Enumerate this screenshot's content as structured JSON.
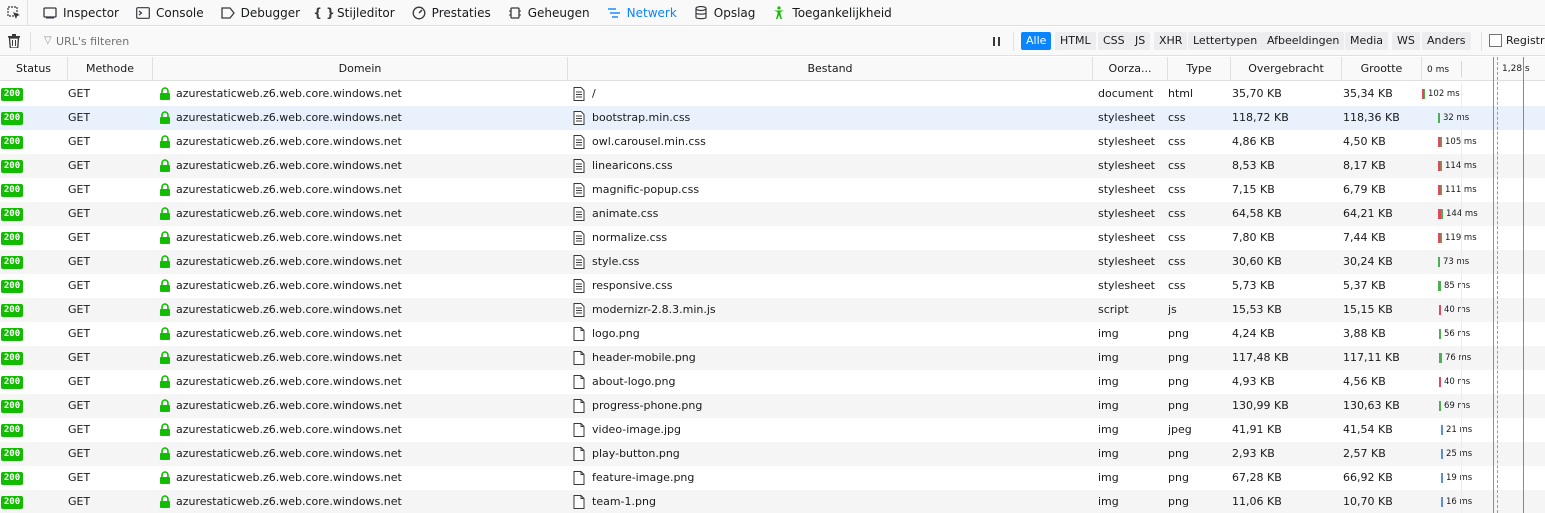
{
  "toolbar": {
    "tabs": [
      {
        "label": "Inspector",
        "icon": "inspector-icon"
      },
      {
        "label": "Console",
        "icon": "console-icon"
      },
      {
        "label": "Debugger",
        "icon": "debugger-icon"
      },
      {
        "label": "Stijleditor",
        "icon": "style-editor-icon"
      },
      {
        "label": "Prestaties",
        "icon": "performance-icon"
      },
      {
        "label": "Geheugen",
        "icon": "memory-icon"
      },
      {
        "label": "Netwerk",
        "icon": "network-icon",
        "active": true
      },
      {
        "label": "Opslag",
        "icon": "storage-icon"
      },
      {
        "label": "Toegankelijkheid",
        "icon": "accessibility-icon"
      }
    ]
  },
  "filter": {
    "placeholder": "URL's filteren",
    "types": [
      "Alle",
      "HTML",
      "CSS",
      "JS",
      "XHR",
      "Lettertypen",
      "Afbeeldingen",
      "Media",
      "WS",
      "Anders"
    ],
    "active_type": "Alle",
    "persist_label": "Registra"
  },
  "columns": {
    "status": "Status",
    "method": "Methode",
    "domain": "Domein",
    "file": "Bestand",
    "cause": "Oorza...",
    "type": "Type",
    "transferred": "Overgebracht",
    "size": "Grootte",
    "timeline_start": "0 ms",
    "timeline_mark": "1,28 s"
  },
  "colors": {
    "accent": "#0a84ff",
    "status_ok": "#12bc00",
    "bar_red": "#e3475b",
    "bar_green": "#4caf50",
    "bar_blue": "#5b8fd8",
    "line_blue": "#5b9bd5",
    "line_pink": "#e44fc8"
  },
  "rows": [
    {
      "status": "200",
      "method": "GET",
      "domain": "azurestaticweb.z6.web.core.windows.net",
      "file": "/",
      "file_kind": "doc",
      "cause": "document",
      "type": "html",
      "transferred": "35,70 KB",
      "size": "35,34 KB",
      "time": "102 ms",
      "time_ms": 102,
      "bar_start": 0.0
    },
    {
      "status": "200",
      "method": "GET",
      "domain": "azurestaticweb.z6.web.core.windows.net",
      "file": "bootstrap.min.css",
      "file_kind": "doc",
      "cause": "stylesheet",
      "type": "css",
      "transferred": "118,72 KB",
      "size": "118,36 KB",
      "time": "32 ms",
      "time_ms": 32,
      "bar_start": 0.16
    },
    {
      "status": "200",
      "method": "GET",
      "domain": "azurestaticweb.z6.web.core.windows.net",
      "file": "owl.carousel.min.css",
      "file_kind": "doc",
      "cause": "stylesheet",
      "type": "css",
      "transferred": "4,86 KB",
      "size": "4,50 KB",
      "time": "105 ms",
      "time_ms": 105,
      "bar_start": 0.16
    },
    {
      "status": "200",
      "method": "GET",
      "domain": "azurestaticweb.z6.web.core.windows.net",
      "file": "linearicons.css",
      "file_kind": "doc",
      "cause": "stylesheet",
      "type": "css",
      "transferred": "8,53 KB",
      "size": "8,17 KB",
      "time": "114 ms",
      "time_ms": 114,
      "bar_start": 0.16
    },
    {
      "status": "200",
      "method": "GET",
      "domain": "azurestaticweb.z6.web.core.windows.net",
      "file": "magnific-popup.css",
      "file_kind": "doc",
      "cause": "stylesheet",
      "type": "css",
      "transferred": "7,15 KB",
      "size": "6,79 KB",
      "time": "111 ms",
      "time_ms": 111,
      "bar_start": 0.16
    },
    {
      "status": "200",
      "method": "GET",
      "domain": "azurestaticweb.z6.web.core.windows.net",
      "file": "animate.css",
      "file_kind": "doc",
      "cause": "stylesheet",
      "type": "css",
      "transferred": "64,58 KB",
      "size": "64,21 KB",
      "time": "144 ms",
      "time_ms": 144,
      "bar_start": 0.16
    },
    {
      "status": "200",
      "method": "GET",
      "domain": "azurestaticweb.z6.web.core.windows.net",
      "file": "normalize.css",
      "file_kind": "doc",
      "cause": "stylesheet",
      "type": "css",
      "transferred": "7,80 KB",
      "size": "7,44 KB",
      "time": "119 ms",
      "time_ms": 119,
      "bar_start": 0.16
    },
    {
      "status": "200",
      "method": "GET",
      "domain": "azurestaticweb.z6.web.core.windows.net",
      "file": "style.css",
      "file_kind": "doc",
      "cause": "stylesheet",
      "type": "css",
      "transferred": "30,60 KB",
      "size": "30,24 KB",
      "time": "73 ms",
      "time_ms": 73,
      "bar_start": 0.16
    },
    {
      "status": "200",
      "method": "GET",
      "domain": "azurestaticweb.z6.web.core.windows.net",
      "file": "responsive.css",
      "file_kind": "doc",
      "cause": "stylesheet",
      "type": "css",
      "transferred": "5,73 KB",
      "size": "5,37 KB",
      "time": "85 ms",
      "time_ms": 85,
      "bar_start": 0.16
    },
    {
      "status": "200",
      "method": "GET",
      "domain": "azurestaticweb.z6.web.core.windows.net",
      "file": "modernizr-2.8.3.min.js",
      "file_kind": "doc",
      "cause": "script",
      "type": "js",
      "transferred": "15,53 KB",
      "size": "15,15 KB",
      "time": "40 ms",
      "time_ms": 40,
      "bar_start": 0.17
    },
    {
      "status": "200",
      "method": "GET",
      "domain": "azurestaticweb.z6.web.core.windows.net",
      "file": "logo.png",
      "file_kind": "blank",
      "cause": "img",
      "type": "png",
      "transferred": "4,24 KB",
      "size": "3,88 KB",
      "time": "56 ms",
      "time_ms": 56,
      "bar_start": 0.17
    },
    {
      "status": "200",
      "method": "GET",
      "domain": "azurestaticweb.z6.web.core.windows.net",
      "file": "header-mobile.png",
      "file_kind": "blank",
      "cause": "img",
      "type": "png",
      "transferred": "117,48 KB",
      "size": "117,11 KB",
      "time": "76 ms",
      "time_ms": 76,
      "bar_start": 0.17
    },
    {
      "status": "200",
      "method": "GET",
      "domain": "azurestaticweb.z6.web.core.windows.net",
      "file": "about-logo.png",
      "file_kind": "blank",
      "cause": "img",
      "type": "png",
      "transferred": "4,93 KB",
      "size": "4,56 KB",
      "time": "40 ms",
      "time_ms": 40,
      "bar_start": 0.17
    },
    {
      "status": "200",
      "method": "GET",
      "domain": "azurestaticweb.z6.web.core.windows.net",
      "file": "progress-phone.png",
      "file_kind": "blank",
      "cause": "img",
      "type": "png",
      "transferred": "130,99 KB",
      "size": "130,63 KB",
      "time": "69 ms",
      "time_ms": 69,
      "bar_start": 0.17
    },
    {
      "status": "200",
      "method": "GET",
      "domain": "azurestaticweb.z6.web.core.windows.net",
      "file": "video-image.jpg",
      "file_kind": "blank",
      "cause": "img",
      "type": "jpeg",
      "transferred": "41,91 KB",
      "size": "41,54 KB",
      "time": "21 ms",
      "time_ms": 21,
      "bar_start": 0.19
    },
    {
      "status": "200",
      "method": "GET",
      "domain": "azurestaticweb.z6.web.core.windows.net",
      "file": "play-button.png",
      "file_kind": "blank",
      "cause": "img",
      "type": "png",
      "transferred": "2,93 KB",
      "size": "2,57 KB",
      "time": "25 ms",
      "time_ms": 25,
      "bar_start": 0.19
    },
    {
      "status": "200",
      "method": "GET",
      "domain": "azurestaticweb.z6.web.core.windows.net",
      "file": "feature-image.png",
      "file_kind": "blank",
      "cause": "img",
      "type": "png",
      "transferred": "67,28 KB",
      "size": "66,92 KB",
      "time": "19 ms",
      "time_ms": 19,
      "bar_start": 0.19
    },
    {
      "status": "200",
      "method": "GET",
      "domain": "azurestaticweb.z6.web.core.windows.net",
      "file": "team-1.png",
      "file_kind": "blank",
      "cause": "img",
      "type": "png",
      "transferred": "11,06 KB",
      "size": "10,70 KB",
      "time": "16 ms",
      "time_ms": 16,
      "bar_start": 0.19
    }
  ]
}
